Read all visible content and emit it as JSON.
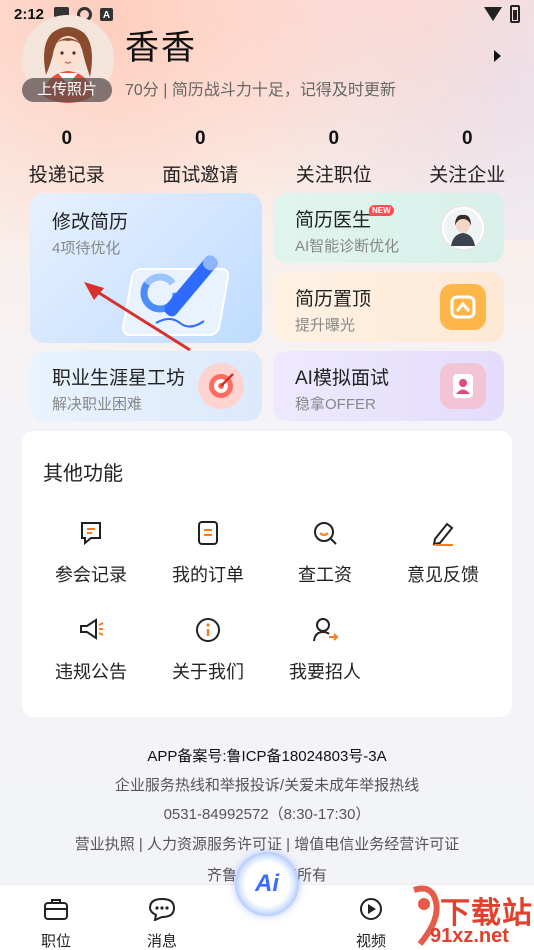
{
  "status_bar": {
    "time": "2:12"
  },
  "profile": {
    "name": "香香",
    "upload_label": "上传照片",
    "score_line": "70分 | 简历战斗力十足，记得及时更新"
  },
  "stats": [
    {
      "value": "0",
      "label": "投递记录"
    },
    {
      "value": "0",
      "label": "面试邀请"
    },
    {
      "value": "0",
      "label": "关注职位"
    },
    {
      "value": "0",
      "label": "关注企业"
    }
  ],
  "cards": {
    "resume": {
      "title": "修改简历",
      "sub": "4项待优化"
    },
    "doctor": {
      "title": "简历医生",
      "sub": "AI智能诊断优化",
      "badge": "NEW"
    },
    "top": {
      "title": "简历置顶",
      "sub": "提升曝光"
    },
    "career": {
      "title": "职业生涯星工坊",
      "sub": "解决职业困难"
    },
    "ai_interview": {
      "title": "AI模拟面试",
      "sub": "稳拿OFFER"
    }
  },
  "other": {
    "title": "其他功能",
    "items": [
      {
        "label": "参会记录",
        "icon": "chat-icon"
      },
      {
        "label": "我的订单",
        "icon": "order-icon"
      },
      {
        "label": "查工资",
        "icon": "search-salary-icon"
      },
      {
        "label": "意见反馈",
        "icon": "pencil-icon"
      },
      {
        "label": "违规公告",
        "icon": "megaphone-icon"
      },
      {
        "label": "关于我们",
        "icon": "info-icon"
      },
      {
        "label": "我要招人",
        "icon": "recruit-icon"
      }
    ]
  },
  "footer": {
    "icp": "APP备案号:鲁ICP备18024803号-3A",
    "hotline": "企业服务热线和举报投诉/关爱未成年举报热线",
    "phone": "0531-84992572（8:30-17:30）",
    "licenses": "营业执照 | 人力资源服务许可证 | 增值电信业务经营许可证",
    "copyright": "齐鲁人才版权所有"
  },
  "nav": {
    "jobs": "职位",
    "messages": "消息",
    "ai": "Ai",
    "video": "视频"
  },
  "watermark": {
    "text": "下载站",
    "url": "91xz.net"
  },
  "colors": {
    "accent": "#ff7a1a",
    "ai_blue": "#3b6dff",
    "watermark_red": "#e0402c"
  }
}
